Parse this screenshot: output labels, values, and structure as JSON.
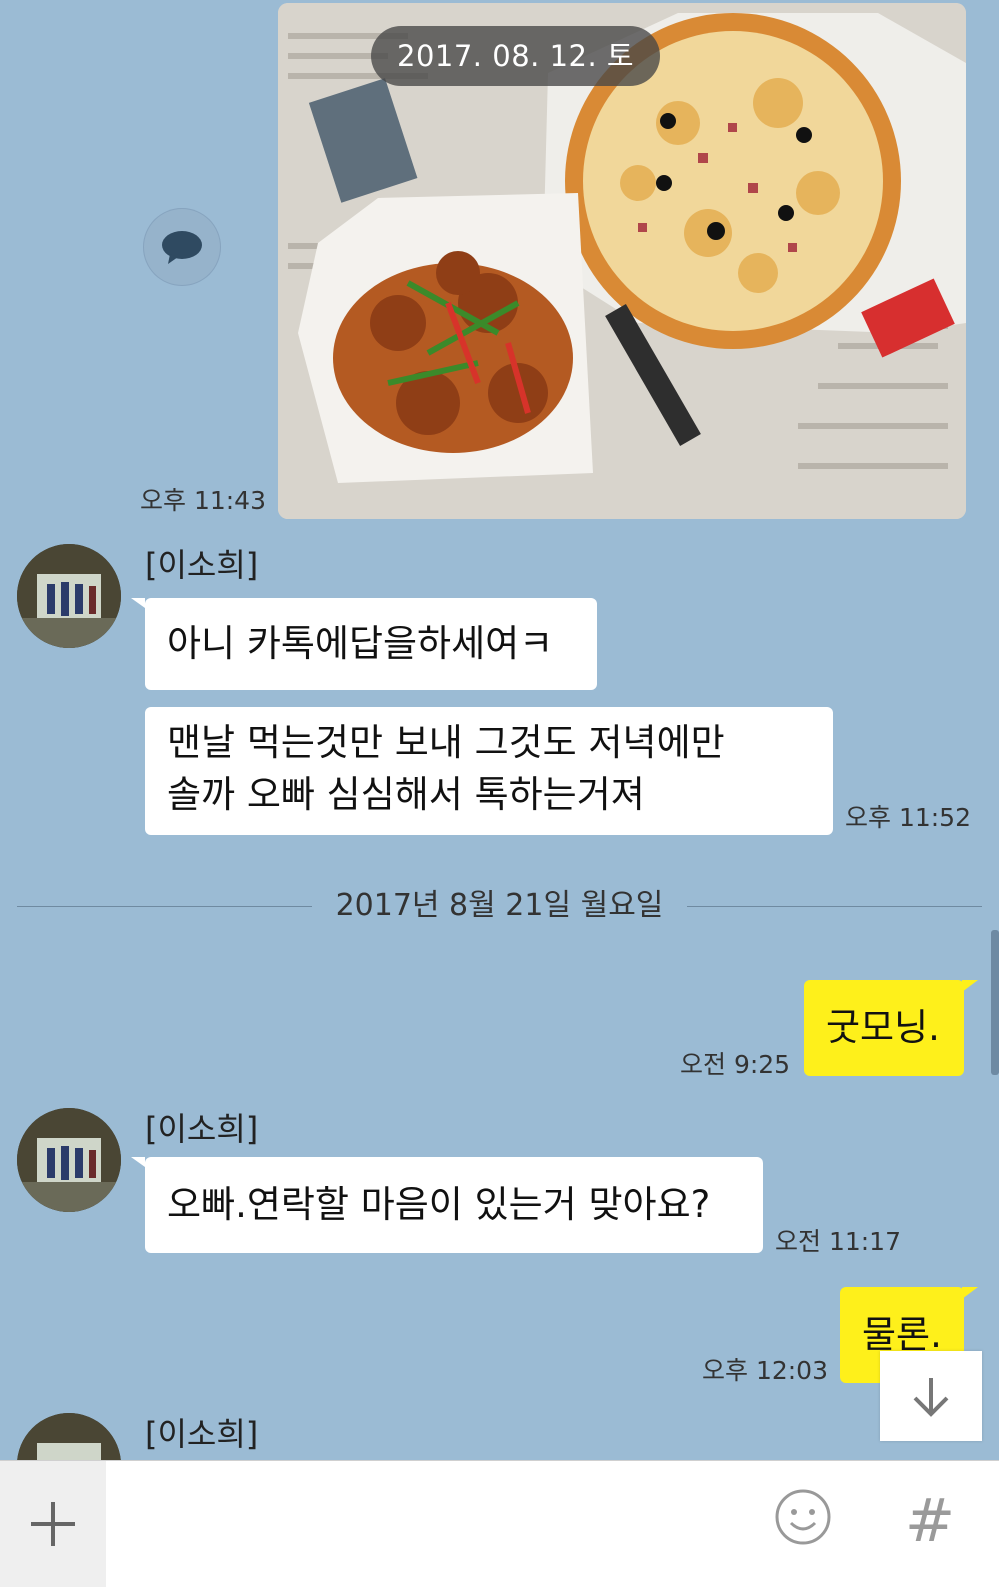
{
  "photo_message": {
    "date_overlay": "2017. 08. 12. 토",
    "time": "오후 11:43"
  },
  "messages_block1": {
    "sender": "[이소희]",
    "bubble1": "아니 카톡에답을하세여ㅋ",
    "bubble2_line1": "맨날 먹는것만 보내 그것도 저녁에만",
    "bubble2_line2": "솔까 오빠 심심해서 톡하는거져",
    "time": "오후 11:52"
  },
  "date_divider": "2017년 8월 21일 월요일",
  "my_message1": {
    "text": "굿모닝.",
    "time": "오전 9:25"
  },
  "messages_block2": {
    "sender": "[이소희]",
    "bubble1": "오빠.연락할 마음이 있는거 맞아요?",
    "time": "오전 11:17"
  },
  "my_message2": {
    "text": "물론.",
    "time": "오후 12:03"
  },
  "messages_block3": {
    "sender": "[이소희]"
  },
  "input_bar": {
    "placeholder": "",
    "hash_label": "#"
  },
  "colors": {
    "background": "#9bbbd4",
    "my_bubble": "#fef01b",
    "their_bubble": "#ffffff"
  },
  "icons": [
    "chat-bubble-icon",
    "arrow-down-icon",
    "plus-icon",
    "emoji-icon",
    "hash-icon"
  ]
}
